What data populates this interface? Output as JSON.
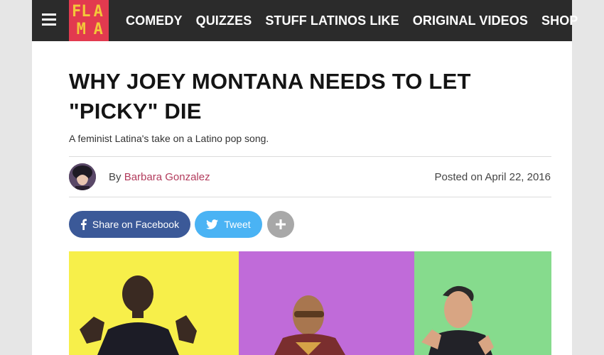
{
  "brand": {
    "logo_letters": [
      "FL",
      "A",
      "M",
      "A"
    ],
    "logo_bg": "#e23a4f",
    "logo_fg": "#f3c73a"
  },
  "nav": {
    "items": [
      {
        "label": "COMEDY"
      },
      {
        "label": "QUIZZES"
      },
      {
        "label": "STUFF LATINOS LIKE"
      },
      {
        "label": "ORIGINAL VIDEOS"
      },
      {
        "label": "SHOP"
      }
    ]
  },
  "article": {
    "title": "WHY JOEY MONTANA NEEDS TO LET \"PICKY\" DIE",
    "subtitle": "A feminist Latina's take on a Latino pop song.",
    "byline_prefix": "By ",
    "author": "Barbara Gonzalez",
    "posted": "Posted on April 22, 2016"
  },
  "share": {
    "facebook_label": "Share on Facebook",
    "twitter_label": "Tweet",
    "more_icon": "plus-icon"
  },
  "hero": {
    "panel_colors": [
      "#f7ef4a",
      "#c06bd9",
      "#86db8d"
    ]
  },
  "colors": {
    "topbar": "#2b2b2b",
    "author_link": "#b23b5c",
    "facebook": "#3b5998",
    "twitter": "#4ab3f4"
  }
}
